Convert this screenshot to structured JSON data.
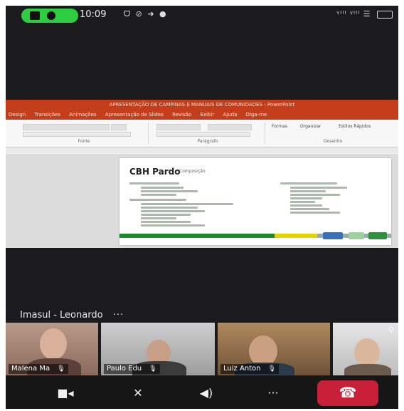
{
  "status_bar": {
    "time": "10:09",
    "notification_icons": "ᗜ ⊘ ➜ ●",
    "signal_icons": "ᵞᴵᴵᴵ ᵞᴵᴵᴵ ☰"
  },
  "shared_screen": {
    "window_title": "APRESENTAÇÃO DE CAMPINAS E MANUAIS DE COMUNIDADES - PowerPoint",
    "ribbon_tabs": [
      "Design",
      "Transições",
      "Animações",
      "Apresentação de Slides",
      "Revisão",
      "Exibir",
      "Ajuda",
      "Diga-me"
    ],
    "ribbon_groups": [
      "Fonte",
      "Parágrafo",
      "Desenho"
    ],
    "ribbon_buttons": [
      "Formas",
      "Organizar",
      "Estilos Rápidos"
    ],
    "slide": {
      "title": "CBH Pardo",
      "subtitle": "Composição"
    }
  },
  "active_speaker": {
    "name": "Imasul - Leonardo",
    "more_label": "···"
  },
  "participants": [
    {
      "name": "Malena Ma",
      "muted": true
    },
    {
      "name": "Paulo Edu",
      "muted": true
    },
    {
      "name": "Luiz Anton",
      "muted": true
    },
    {
      "name": "",
      "muted": false
    }
  ],
  "controls": {
    "camera": "camera-icon",
    "mic": "mic-off-icon",
    "speaker": "speaker-icon",
    "more": "more-icon",
    "end": "end-call-icon"
  },
  "colors": {
    "end_call": "#c9203a",
    "call_pill": "#2ecc40",
    "ppt_red": "#c43e1c"
  }
}
